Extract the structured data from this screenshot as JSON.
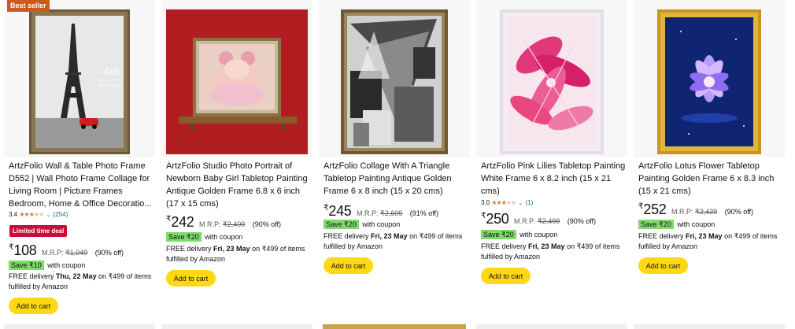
{
  "cards": [
    {
      "badge": "Best seller",
      "title": "ArtzFolio Wall & Table Photo Frame D552 | Wall Photo Frame Collage for Living Room | Picture Frames Bedroom, Home & Office Decoratio...",
      "image_text": {
        "size": "4x6",
        "caption": "Photo print size",
        "brand": "ARTZFOLIO"
      },
      "rating": {
        "value": "3.4",
        "stars": 3.4,
        "count": "(254)"
      },
      "deal": "Limited time deal",
      "price": {
        "symbol": "₹",
        "amount": "108",
        "mrp_label": "M.R.P:",
        "mrp": "₹1,049",
        "off": "(90% off)"
      },
      "coupon": {
        "save": "Save ₹10",
        "text": "with coupon"
      },
      "delivery": {
        "prefix": "FREE delivery ",
        "date": "Thu, 22 May",
        "suffix": " on ₹499 of items fulfilled by Amazon"
      },
      "cart_label": "Add to cart"
    },
    {
      "title": "ArtzFolio Studio Photo Portrait of Newborn Baby Girl Tabletop Painting Antique Golden Frame 6.8 x 6 inch (17 x 15 cms)",
      "price": {
        "symbol": "₹",
        "amount": "242",
        "mrp_label": "M.R.P:",
        "mrp": "₹2,409",
        "off": "(90% off)"
      },
      "coupon": {
        "save": "Save ₹20",
        "text": "with coupon"
      },
      "delivery": {
        "prefix": "FREE delivery ",
        "date": "Fri, 23 May",
        "suffix": " on ₹499 of items fulfilled by Amazon"
      },
      "cart_label": "Add to cart"
    },
    {
      "title": "ArtzFolio Collage With A Triangle Tabletop Painting Antique Golden Frame 6 x 8 inch (15 x 20 cms)",
      "price": {
        "symbol": "₹",
        "amount": "245",
        "mrp_label": "M.R.P:",
        "mrp": "₹2,609",
        "off": "(91% off)"
      },
      "coupon": {
        "save": "Save ₹20",
        "text": "with coupon"
      },
      "delivery": {
        "prefix": "FREE delivery ",
        "date": "Fri, 23 May",
        "suffix": " on ₹499 of items fulfilled by Amazon"
      },
      "cart_label": "Add to cart"
    },
    {
      "title": "ArtzFolio Pink Lilies Tabletop Painting White Frame 6 x 8.2 inch (15 x 21 cms)",
      "rating": {
        "value": "3.0",
        "stars": 3.0,
        "count": "(1)"
      },
      "price": {
        "symbol": "₹",
        "amount": "250",
        "mrp_label": "M.R.P:",
        "mrp": "₹2,499",
        "off": "(90% off)"
      },
      "coupon": {
        "save": "Save ₹20",
        "text": "with coupon"
      },
      "delivery": {
        "prefix": "FREE delivery ",
        "date": "Fri, 23 May",
        "suffix": " on ₹499 of items fulfilled by Amazon"
      },
      "cart_label": "Add to cart"
    },
    {
      "title": "ArtzFolio Lotus Flower Tabletop Painting Golden Frame 6 x 8.3 inch (15 x 21 cms)",
      "price": {
        "symbol": "₹",
        "amount": "252",
        "mrp_label": "M.R.P:",
        "mrp": "₹2,439",
        "off": "(90% off)"
      },
      "coupon": {
        "save": "Save ₹20",
        "text": "with coupon"
      },
      "delivery": {
        "prefix": "FREE delivery ",
        "date": "Fri, 23 May",
        "suffix": " on ₹499 of items fulfilled by Amazon"
      },
      "cart_label": "Add to cart"
    }
  ],
  "colors": {
    "accent_cart": "#ffd814",
    "deal_red": "#cc0c39",
    "coupon_green": "#7fda69",
    "badge_orange": "#cc5a1e",
    "link": "#007185",
    "star": "#de7921"
  }
}
